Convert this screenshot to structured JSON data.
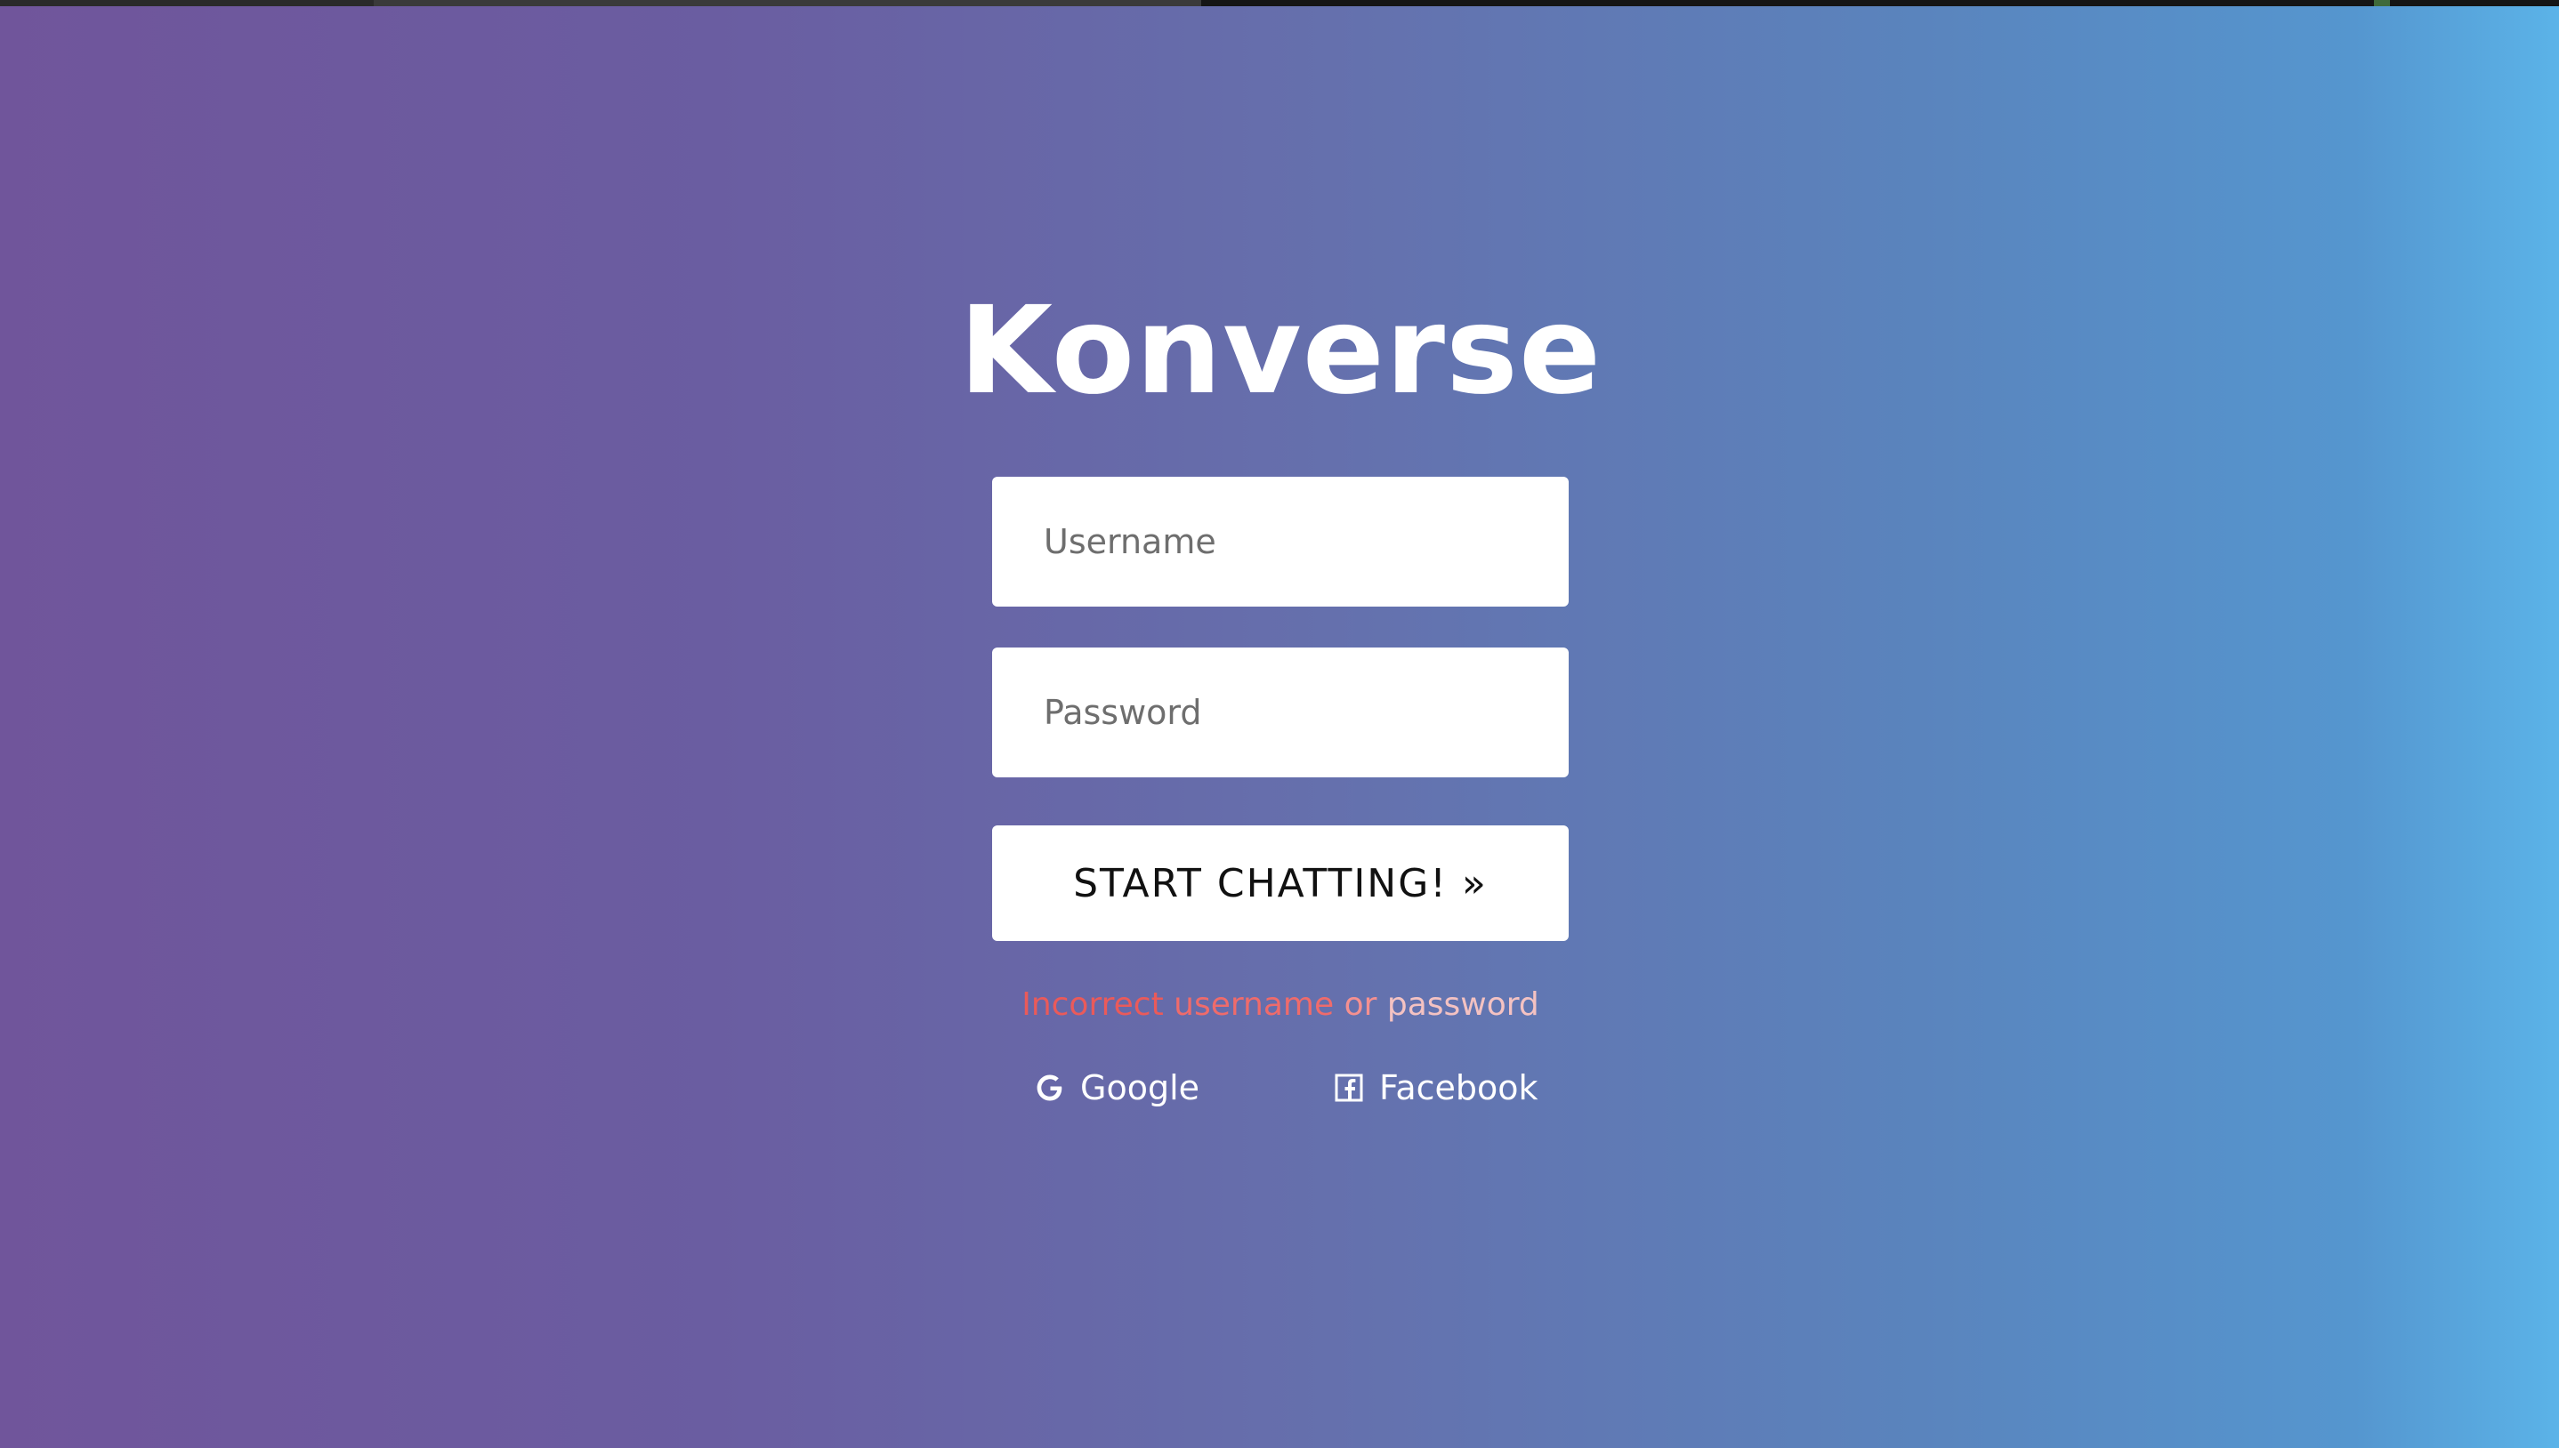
{
  "app": {
    "title": "Konverse"
  },
  "form": {
    "username_placeholder": "Username",
    "username_value": "",
    "password_placeholder": "Password",
    "password_value": "",
    "submit_label": "START CHATTING!  »"
  },
  "error": {
    "words": [
      "Incorrect",
      "username",
      "or",
      "password"
    ],
    "colors": {
      "start": "#ea5a5a",
      "end": "#f4c2c2"
    }
  },
  "social": {
    "google_label": "Google",
    "google_icon": "google-icon",
    "facebook_label": "Facebook",
    "facebook_icon": "facebook-icon"
  },
  "theme": {
    "gradient_start": "#70559b",
    "gradient_end": "#5bb3e8",
    "field_background": "#ffffff"
  }
}
